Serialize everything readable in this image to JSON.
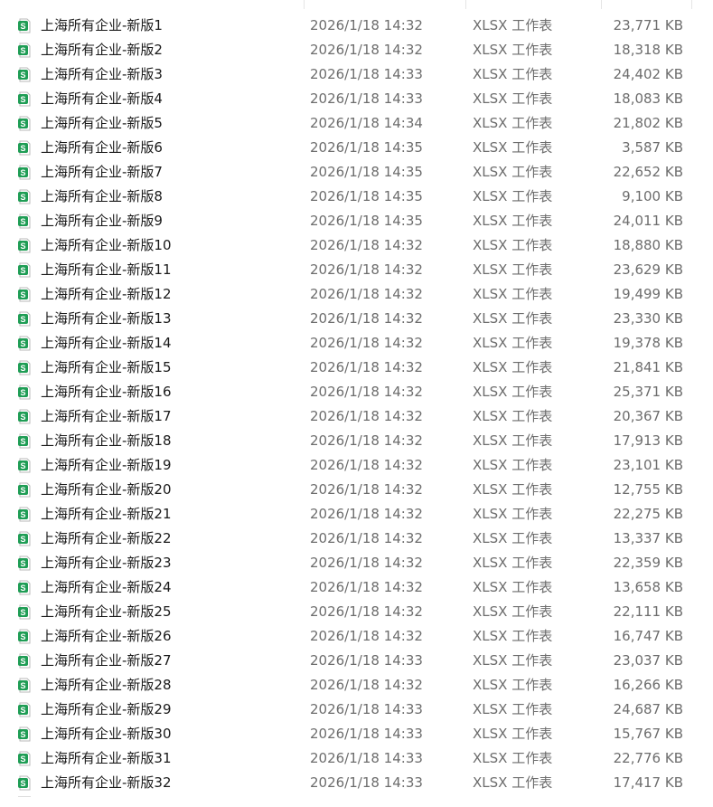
{
  "icons": {
    "file_icon": "xlsx-sheet-icon",
    "file_icon_color": "#1f9d55",
    "file_icon_letter": "S"
  },
  "files": [
    {
      "name": "上海所有企业-新版1",
      "modified": "2026/1/18 14:32",
      "type": "XLSX 工作表",
      "size": "23,771 KB"
    },
    {
      "name": "上海所有企业-新版2",
      "modified": "2026/1/18 14:32",
      "type": "XLSX 工作表",
      "size": "18,318 KB"
    },
    {
      "name": "上海所有企业-新版3",
      "modified": "2026/1/18 14:33",
      "type": "XLSX 工作表",
      "size": "24,402 KB"
    },
    {
      "name": "上海所有企业-新版4",
      "modified": "2026/1/18 14:33",
      "type": "XLSX 工作表",
      "size": "18,083 KB"
    },
    {
      "name": "上海所有企业-新版5",
      "modified": "2026/1/18 14:34",
      "type": "XLSX 工作表",
      "size": "21,802 KB"
    },
    {
      "name": "上海所有企业-新版6",
      "modified": "2026/1/18 14:35",
      "type": "XLSX 工作表",
      "size": "3,587 KB"
    },
    {
      "name": "上海所有企业-新版7",
      "modified": "2026/1/18 14:35",
      "type": "XLSX 工作表",
      "size": "22,652 KB"
    },
    {
      "name": "上海所有企业-新版8",
      "modified": "2026/1/18 14:35",
      "type": "XLSX 工作表",
      "size": "9,100 KB"
    },
    {
      "name": "上海所有企业-新版9",
      "modified": "2026/1/18 14:35",
      "type": "XLSX 工作表",
      "size": "24,011 KB"
    },
    {
      "name": "上海所有企业-新版10",
      "modified": "2026/1/18 14:32",
      "type": "XLSX 工作表",
      "size": "18,880 KB"
    },
    {
      "name": "上海所有企业-新版11",
      "modified": "2026/1/18 14:32",
      "type": "XLSX 工作表",
      "size": "23,629 KB"
    },
    {
      "name": "上海所有企业-新版12",
      "modified": "2026/1/18 14:32",
      "type": "XLSX 工作表",
      "size": "19,499 KB"
    },
    {
      "name": "上海所有企业-新版13",
      "modified": "2026/1/18 14:32",
      "type": "XLSX 工作表",
      "size": "23,330 KB"
    },
    {
      "name": "上海所有企业-新版14",
      "modified": "2026/1/18 14:32",
      "type": "XLSX 工作表",
      "size": "19,378 KB"
    },
    {
      "name": "上海所有企业-新版15",
      "modified": "2026/1/18 14:32",
      "type": "XLSX 工作表",
      "size": "21,841 KB"
    },
    {
      "name": "上海所有企业-新版16",
      "modified": "2026/1/18 14:32",
      "type": "XLSX 工作表",
      "size": "25,371 KB"
    },
    {
      "name": "上海所有企业-新版17",
      "modified": "2026/1/18 14:32",
      "type": "XLSX 工作表",
      "size": "20,367 KB"
    },
    {
      "name": "上海所有企业-新版18",
      "modified": "2026/1/18 14:32",
      "type": "XLSX 工作表",
      "size": "17,913 KB"
    },
    {
      "name": "上海所有企业-新版19",
      "modified": "2026/1/18 14:32",
      "type": "XLSX 工作表",
      "size": "23,101 KB"
    },
    {
      "name": "上海所有企业-新版20",
      "modified": "2026/1/18 14:32",
      "type": "XLSX 工作表",
      "size": "12,755 KB"
    },
    {
      "name": "上海所有企业-新版21",
      "modified": "2026/1/18 14:32",
      "type": "XLSX 工作表",
      "size": "22,275 KB"
    },
    {
      "name": "上海所有企业-新版22",
      "modified": "2026/1/18 14:32",
      "type": "XLSX 工作表",
      "size": "13,337 KB"
    },
    {
      "name": "上海所有企业-新版23",
      "modified": "2026/1/18 14:32",
      "type": "XLSX 工作表",
      "size": "22,359 KB"
    },
    {
      "name": "上海所有企业-新版24",
      "modified": "2026/1/18 14:32",
      "type": "XLSX 工作表",
      "size": "13,658 KB"
    },
    {
      "name": "上海所有企业-新版25",
      "modified": "2026/1/18 14:32",
      "type": "XLSX 工作表",
      "size": "22,111 KB"
    },
    {
      "name": "上海所有企业-新版26",
      "modified": "2026/1/18 14:32",
      "type": "XLSX 工作表",
      "size": "16,747 KB"
    },
    {
      "name": "上海所有企业-新版27",
      "modified": "2026/1/18 14:33",
      "type": "XLSX 工作表",
      "size": "23,037 KB"
    },
    {
      "name": "上海所有企业-新版28",
      "modified": "2026/1/18 14:32",
      "type": "XLSX 工作表",
      "size": "16,266 KB"
    },
    {
      "name": "上海所有企业-新版29",
      "modified": "2026/1/18 14:33",
      "type": "XLSX 工作表",
      "size": "24,687 KB"
    },
    {
      "name": "上海所有企业-新版30",
      "modified": "2026/1/18 14:33",
      "type": "XLSX 工作表",
      "size": "15,767 KB"
    },
    {
      "name": "上海所有企业-新版31",
      "modified": "2026/1/18 14:33",
      "type": "XLSX 工作表",
      "size": "22,776 KB"
    },
    {
      "name": "上海所有企业-新版32",
      "modified": "2026/1/18 14:33",
      "type": "XLSX 工作表",
      "size": "17,417 KB"
    }
  ]
}
